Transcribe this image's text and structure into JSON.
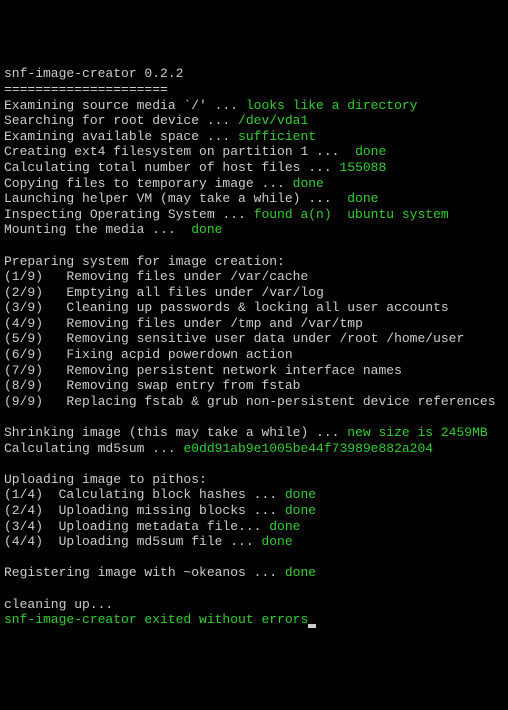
{
  "header": {
    "title": "snf-image-creator 0.2.2",
    "divider": "====================="
  },
  "lines": [
    {
      "prefix": "Examining source media `/' ... ",
      "result": "looks like a directory"
    },
    {
      "prefix": "Searching for root device ... ",
      "result": "/dev/vda1"
    },
    {
      "prefix": "Examining available space ... ",
      "result": "sufficient"
    },
    {
      "prefix": "Creating ext4 filesystem on partition 1 ...  ",
      "result": "done"
    },
    {
      "prefix": "Calculating total number of host files ... ",
      "result": "155088"
    },
    {
      "prefix": "Copying files to temporary image ... ",
      "result": "done"
    },
    {
      "prefix": "Launching helper VM (may take a while) ...  ",
      "result": "done"
    },
    {
      "prefix": "Inspecting Operating System ... ",
      "result": "found a(n)  ubuntu system"
    },
    {
      "prefix": "Mounting the media ...  ",
      "result": "done"
    }
  ],
  "prep": {
    "heading": "Preparing system for image creation:",
    "steps": [
      {
        "idx": "(1/9)   ",
        "text": "Removing files under /var/cache"
      },
      {
        "idx": "(2/9)   ",
        "text": "Emptying all files under /var/log"
      },
      {
        "idx": "(3/9)   ",
        "text": "Cleaning up passwords & locking all user accounts"
      },
      {
        "idx": "(4/9)   ",
        "text": "Removing files under /tmp and /var/tmp"
      },
      {
        "idx": "(5/9)   ",
        "text": "Removing sensitive user data under /root /home/user"
      },
      {
        "idx": "(6/9)   ",
        "text": "Fixing acpid powerdown action"
      },
      {
        "idx": "(7/9)   ",
        "text": "Removing persistent network interface names"
      },
      {
        "idx": "(8/9)   ",
        "text": "Removing swap entry from fstab"
      },
      {
        "idx": "(9/9)   ",
        "text": "Replacing fstab & grub non-persistent device references"
      }
    ]
  },
  "shrink": {
    "prefix": "Shrinking image (this may take a while) ... ",
    "result": "new size is 2459MB"
  },
  "md5": {
    "prefix": "Calculating md5sum ... ",
    "result": "e0dd91ab9e1005be44f73989e882a204"
  },
  "upload": {
    "heading": "Uploading image to pithos:",
    "steps": [
      {
        "idx": "(1/4)  ",
        "text": "Calculating block hashes ... ",
        "result": "done"
      },
      {
        "idx": "(2/4)  ",
        "text": "Uploading missing blocks ... ",
        "result": "done"
      },
      {
        "idx": "(3/4)  ",
        "text": "Uploading metadata file... ",
        "result": "done"
      },
      {
        "idx": "(4/4)  ",
        "text": "Uploading md5sum file ... ",
        "result": "done"
      }
    ]
  },
  "register": {
    "prefix": "Registering image with ~okeanos ... ",
    "result": "done"
  },
  "cleanup": "cleaning up...",
  "exit": "snf-image-creator exited without errors"
}
